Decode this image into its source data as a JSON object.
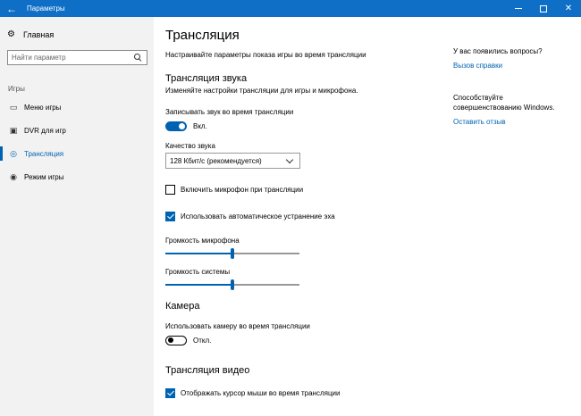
{
  "window": {
    "title": "Параметры",
    "back_icon": "arrow-left-icon",
    "minimize_icon": "minimize-icon",
    "maximize_icon": "maximize-icon",
    "close_icon": "close-icon",
    "accent_color": "#0f6fc6"
  },
  "sidebar": {
    "home_label": "Главная",
    "search_placeholder": "Найти параметр",
    "group_label": "Игры",
    "items": [
      {
        "label": "Меню игры",
        "icon": "game-bar-icon",
        "active": false
      },
      {
        "label": "DVR для игр",
        "icon": "dvr-icon",
        "active": false
      },
      {
        "label": "Трансляция",
        "icon": "broadcast-icon",
        "active": true
      },
      {
        "label": "Режим игры",
        "icon": "game-mode-icon",
        "active": false
      }
    ]
  },
  "main": {
    "title": "Трансляция",
    "subtitle": "Настраивайте параметры показа игры во время трансляции",
    "audio": {
      "title": "Трансляция звука",
      "description": "Изменяйте настройки трансляции для игры и микрофона.",
      "record_label": "Записывать звук во время трансляции",
      "record_state": "Вкл.",
      "quality_label": "Качество звука",
      "quality_value": "128 Кбит/с (рекомендуется)",
      "mic_checkbox_label": "Включить микрофон при трансляции",
      "mic_checkbox_checked": false,
      "echo_checkbox_label": "Использовать автоматическое устранение эха",
      "echo_checkbox_checked": true,
      "mic_volume_label": "Громкость микрофона",
      "mic_volume": 0.5,
      "system_volume_label": "Громкость системы",
      "system_volume": 0.5
    },
    "camera": {
      "title": "Камера",
      "use_camera_label": "Использовать камеру во время трансляции",
      "use_camera_state": "Откл."
    },
    "video": {
      "title": "Трансляция видео",
      "cursor_checkbox_label": "Отображать курсор мыши во время трансляции",
      "cursor_checkbox_checked": true
    }
  },
  "help": {
    "question": "У вас появились вопросы?",
    "help_link": "Вызов справки",
    "improve_text": "Способствуйте совершенствованию Windows.",
    "feedback_link": "Оставить отзыв",
    "link_color": "#0063b1"
  }
}
